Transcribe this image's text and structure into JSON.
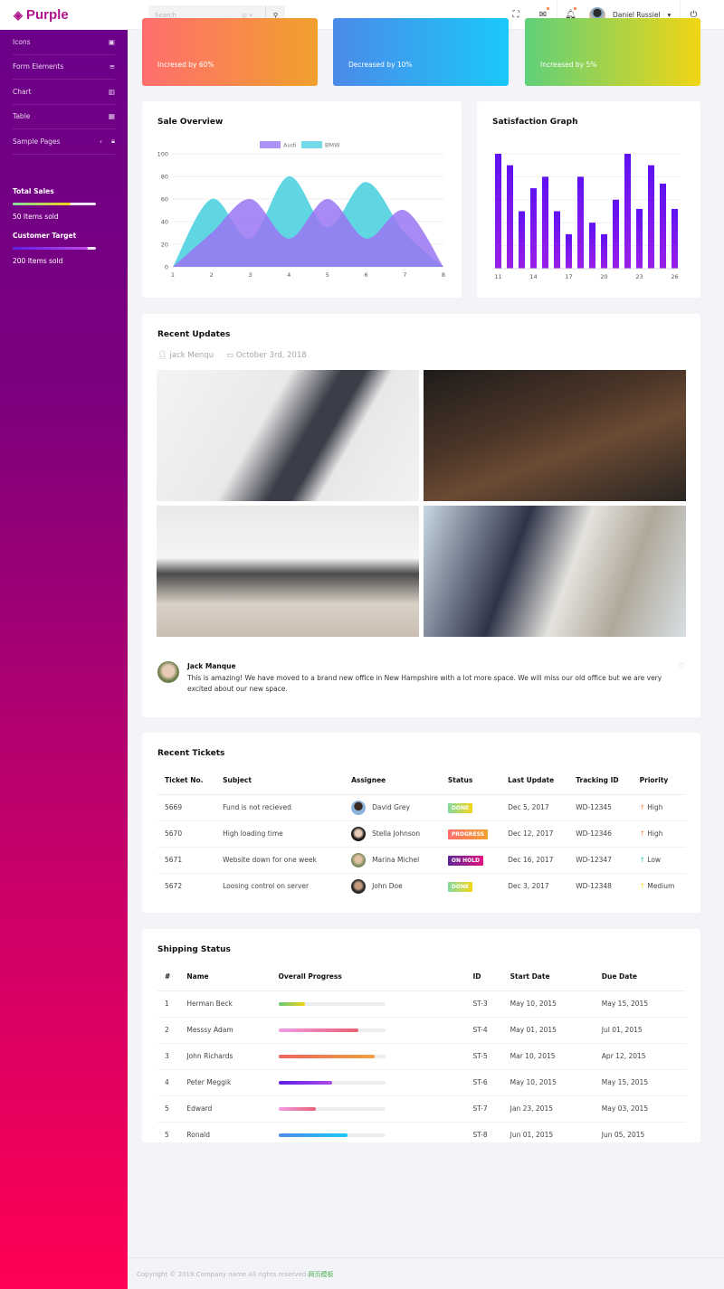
{
  "brand": "Purple",
  "sidebar": {
    "items": [
      {
        "label": "Icons",
        "icon": "contacts-icon"
      },
      {
        "label": "Form Elements",
        "icon": "format-list-icon"
      },
      {
        "label": "Chart",
        "icon": "chart-bar-icon"
      },
      {
        "label": "Table",
        "icon": "table-icon"
      },
      {
        "label": "Sample Pages",
        "icon": "lock-icon"
      }
    ],
    "stats": [
      {
        "title": "Total Sales",
        "progress": 70,
        "caption": "50 Items sold"
      },
      {
        "title": "Customer Target",
        "progress": 90,
        "caption": "200 Items sold"
      }
    ]
  },
  "topbar": {
    "search_placeholder": "Search",
    "user_name": "Daniel Russiel"
  },
  "stat_cards": [
    {
      "caption": "Incresed by 60%",
      "colors": [
        "#ff6e6e",
        "#f1a02d"
      ]
    },
    {
      "caption": "Decreased by 10%",
      "colors": [
        "#4b8ae8",
        "#1ac8fb"
      ]
    },
    {
      "caption": "Increased by 5%",
      "colors": [
        "#5fd07a",
        "#f2d514"
      ]
    }
  ],
  "chart_data": [
    {
      "type": "area",
      "title": "Sale Overview",
      "x": [
        1,
        2,
        3,
        4,
        5,
        6,
        7,
        8
      ],
      "ylim": [
        0,
        100
      ],
      "yticks": [
        0,
        20,
        40,
        60,
        80,
        100
      ],
      "legend": "top",
      "grid": true,
      "series": [
        {
          "name": "Audi",
          "values": [
            0,
            30,
            60,
            25,
            60,
            25,
            50,
            0
          ],
          "color": "#9a76f2"
        },
        {
          "name": "BMW",
          "values": [
            0,
            60,
            25,
            80,
            35,
            75,
            30,
            0
          ],
          "color": "#4fd1e0"
        }
      ]
    },
    {
      "type": "bar",
      "title": "Satisfaction Graph",
      "categories": [
        11,
        12,
        13,
        14,
        15,
        16,
        17,
        18,
        19,
        20,
        21,
        22,
        23,
        24,
        25,
        26
      ],
      "xticks": [
        11,
        14,
        17,
        20,
        23,
        26
      ],
      "values": [
        100,
        90,
        50,
        70,
        80,
        50,
        30,
        80,
        40,
        30,
        60,
        100,
        52,
        90,
        74,
        52
      ],
      "ylim": [
        0,
        100
      ],
      "grid": true,
      "color": "#7a1bf0"
    }
  ],
  "updates": {
    "title": "Recent Updates",
    "author": "jack Menqu",
    "date": "October 3rd, 2018",
    "comment": {
      "name": "Jack Manque",
      "text": "This is amazing! We have moved to a brand new office in New Hampshire with a lot more space. We will miss our old office but we are very excited about our new space."
    }
  },
  "tickets": {
    "title": "Recent Tickets",
    "headers": [
      "Ticket No.",
      "Subject",
      "Assignee",
      "Status",
      "Last Update",
      "Tracking ID",
      "Priority"
    ],
    "rows": [
      {
        "no": "5669",
        "subject": "Fund is not recieved",
        "assignee": "David Grey",
        "status": "DONE",
        "status_bg": "linear-gradient(90deg,#84d9a1,#f2d514)",
        "updated": "Dec 5, 2017",
        "tracking": "WD-12345",
        "priority": "High",
        "pcolor": "#fe7c45"
      },
      {
        "no": "5670",
        "subject": "High loading time",
        "assignee": "Stella Johnson",
        "status": "PROGRESS",
        "status_bg": "linear-gradient(90deg,#ff6e6e,#f1a02d)",
        "updated": "Dec 12, 2017",
        "tracking": "WD-12346",
        "priority": "High",
        "pcolor": "#fe7c45"
      },
      {
        "no": "5671",
        "subject": "Website down for one week",
        "assignee": "Marina Michel",
        "status": "ON HOLD",
        "status_bg": "linear-gradient(90deg,#5c2594,#e0147e)",
        "updated": "Dec 16, 2017",
        "tracking": "WD-12347",
        "priority": "Low",
        "pcolor": "#1bcfb4"
      },
      {
        "no": "5672",
        "subject": "Loosing control on server",
        "assignee": "John Doe",
        "status": "DONE",
        "status_bg": "linear-gradient(90deg,#84d9a1,#f2d514)",
        "updated": "Dec 3, 2017",
        "tracking": "WD-12348",
        "priority": "Medium",
        "pcolor": "#fed713"
      }
    ]
  },
  "shipping": {
    "title": "Shipping Status",
    "headers": [
      "#",
      "Name",
      "Overall Progress",
      "ID",
      "Start Date",
      "Due Date"
    ],
    "rows": [
      {
        "n": "1",
        "name": "Herman Beck",
        "progress": 25,
        "bar": "linear-gradient(90deg,#66c77a,#f2d514)",
        "id": "ST-3",
        "start": "May 10, 2015",
        "due": "May 15, 2015"
      },
      {
        "n": "2",
        "name": "Messsy Adam",
        "progress": 75,
        "bar": "linear-gradient(90deg,#f19ae5,#e86273)",
        "id": "ST-4",
        "start": "May 01, 2015",
        "due": "Jul 01, 2015"
      },
      {
        "n": "3",
        "name": "John Richards",
        "progress": 90,
        "bar": "linear-gradient(90deg,#ee6462,#eda23e)",
        "id": "ST-5",
        "start": "Mar 10, 2015",
        "due": "Apr 12, 2015"
      },
      {
        "n": "4",
        "name": "Peter Meggik",
        "progress": 50,
        "bar": "linear-gradient(90deg,#5b1ee6,#b04ae8)",
        "id": "ST-6",
        "start": "May 10, 2015",
        "due": "May 15, 2015"
      },
      {
        "n": "5",
        "name": "Edward",
        "progress": 35,
        "bar": "linear-gradient(90deg,#f19ae5,#e86273)",
        "id": "ST-7",
        "start": "Jan 23, 2015",
        "due": "May 03, 2015"
      },
      {
        "n": "5",
        "name": "Ronald",
        "progress": 65,
        "bar": "linear-gradient(90deg,#4b8ae8,#1ac8fb)",
        "id": "ST-8",
        "start": "Jun 01, 2015",
        "due": "Jun 05, 2015"
      }
    ]
  },
  "footer": {
    "text": "Copyright © 2019.Company name All rights reserved.",
    "link": "网页模板"
  }
}
